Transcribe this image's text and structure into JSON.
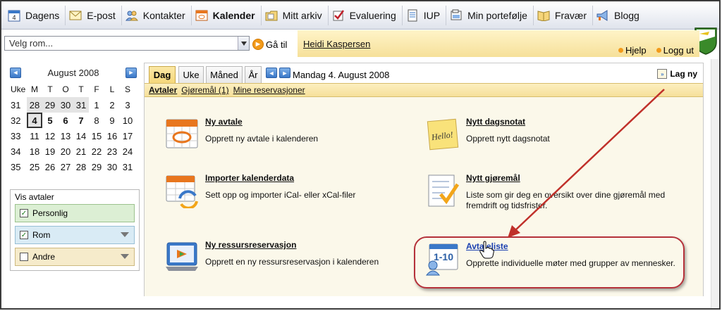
{
  "nav": {
    "items": [
      {
        "label": "Dagens",
        "icon": "calendar-day-icon"
      },
      {
        "label": "E-post",
        "icon": "envelope-icon"
      },
      {
        "label": "Kontakter",
        "icon": "contacts-icon"
      },
      {
        "label": "Kalender",
        "icon": "calendar-icon",
        "active": true
      },
      {
        "label": "Mitt arkiv",
        "icon": "folder-icon"
      },
      {
        "label": "Evaluering",
        "icon": "checkmark-icon"
      },
      {
        "label": "IUP",
        "icon": "document-icon"
      },
      {
        "label": "Min portefølje",
        "icon": "portfolio-icon"
      },
      {
        "label": "Fravær",
        "icon": "book-icon"
      },
      {
        "label": "Blogg",
        "icon": "megaphone-icon"
      }
    ],
    "day_number": "4"
  },
  "toolbar": {
    "room_select_value": "Velg rom...",
    "goto_label": "Gå til",
    "username": "Heidi Kaspersen",
    "help_label": "Hjelp",
    "logout_label": "Logg ut"
  },
  "minical": {
    "title": "August 2008",
    "headers": [
      "Uke",
      "M",
      "T",
      "O",
      "T",
      "F",
      "L",
      "S"
    ],
    "weeks": [
      {
        "wk": "31",
        "days": [
          "28",
          "29",
          "30",
          "31",
          "1",
          "2",
          "3"
        ],
        "prev_count": 4
      },
      {
        "wk": "32",
        "days": [
          "4",
          "5",
          "6",
          "7",
          "8",
          "9",
          "10"
        ],
        "prev_count": 0,
        "bold_count": 4,
        "today_index": 0
      },
      {
        "wk": "33",
        "days": [
          "11",
          "12",
          "13",
          "14",
          "15",
          "16",
          "17"
        ],
        "prev_count": 0
      },
      {
        "wk": "34",
        "days": [
          "18",
          "19",
          "20",
          "21",
          "22",
          "23",
          "24"
        ],
        "prev_count": 0
      },
      {
        "wk": "35",
        "days": [
          "25",
          "26",
          "27",
          "28",
          "29",
          "30",
          "31"
        ],
        "prev_count": 0
      }
    ]
  },
  "vis": {
    "title": "Vis avtaler",
    "rows": [
      {
        "label": "Personlig",
        "checked": true
      },
      {
        "label": "Rom",
        "checked": true
      },
      {
        "label": "Andre",
        "checked": false
      }
    ]
  },
  "main": {
    "tabs": [
      "Dag",
      "Uke",
      "Måned",
      "År"
    ],
    "active_tab": "Dag",
    "date": "Mandag 4. August 2008",
    "new_label": "Lag ny",
    "subtabs": [
      "Avtaler",
      "Gjøremål (1)",
      "Mine reservasjoner"
    ],
    "items": [
      {
        "title": "Ny avtale",
        "desc": "Opprett ny avtale i kalenderen",
        "icon": "new-appointment-icon"
      },
      {
        "title": "Nytt dagsnotat",
        "desc": "Opprett nytt dagsnotat",
        "icon": "day-note-icon",
        "note_text": "Hello!"
      },
      {
        "title": "Importer kalenderdata",
        "desc": "Sett opp og importer iCal- eller xCal-filer",
        "icon": "import-calendar-icon"
      },
      {
        "title": "Nytt gjøremål",
        "desc": "Liste som gir deg en oversikt over dine gjøremål med fremdrift og tidsfrister.",
        "icon": "task-icon"
      },
      {
        "title": "Ny ressursreservasjon",
        "desc": "Opprett en ny ressursreservasjon i kalenderen",
        "icon": "resource-reservation-icon"
      },
      {
        "title": "Avtaleliste",
        "desc": "Opprette individuelle møter med grupper av mennesker.",
        "icon": "appointment-list-icon",
        "badge": "1-10"
      }
    ]
  },
  "colors": {
    "accent_yellow": "#f6e09a",
    "highlight_red": "#b5313a",
    "link_blue": "#1a3fb0"
  }
}
